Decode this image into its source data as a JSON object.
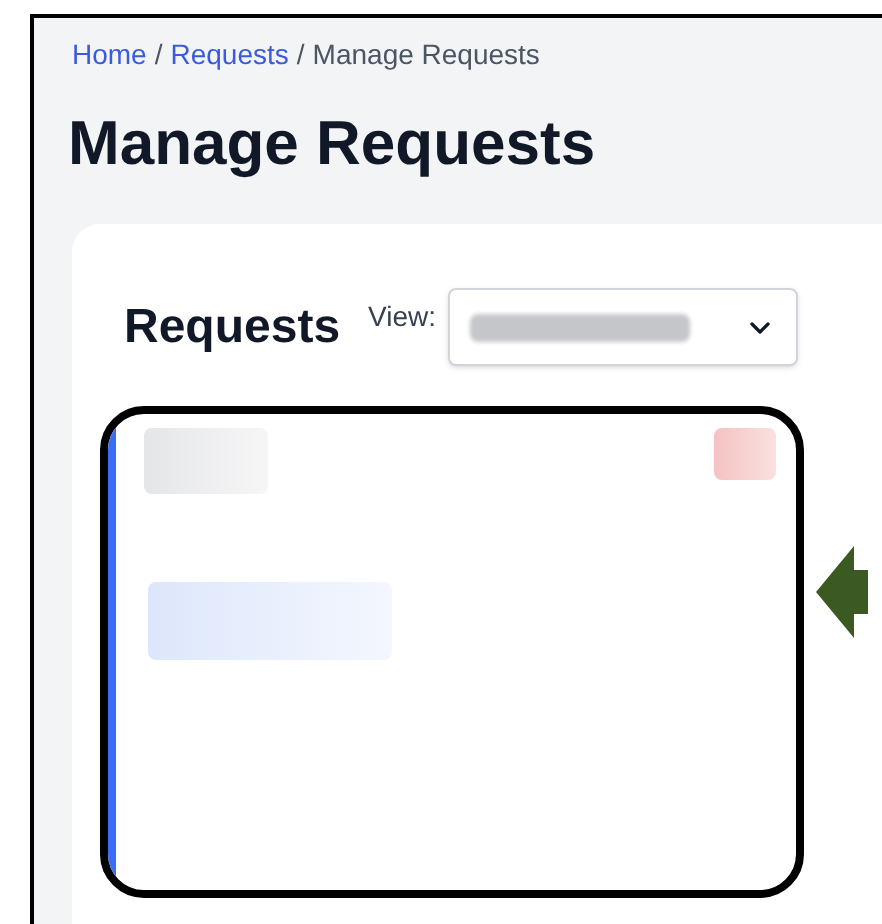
{
  "breadcrumb": [
    {
      "label": "Home",
      "kind": "link"
    },
    {
      "label": "Requests",
      "kind": "link"
    },
    {
      "label": "Manage Requests",
      "kind": "current"
    }
  ],
  "breadcrumb_separator": "/",
  "title": "Manage Requests",
  "panel": {
    "heading": "Requests",
    "view_label": "View:"
  }
}
